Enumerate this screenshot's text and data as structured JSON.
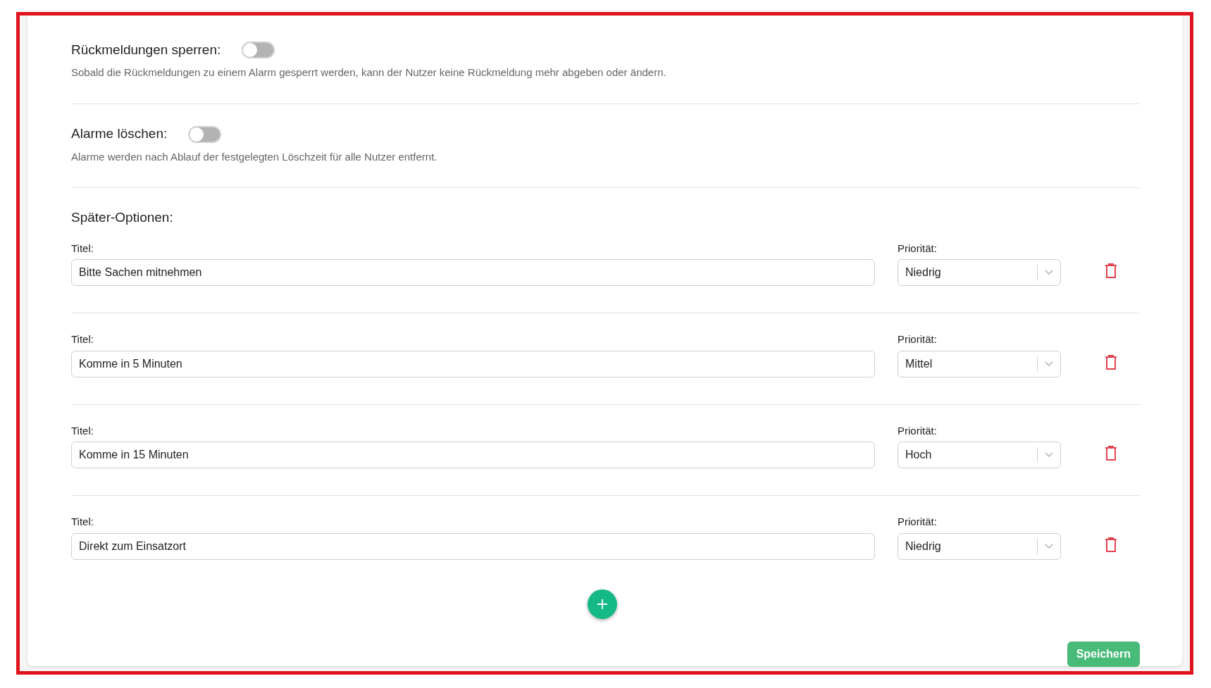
{
  "settings": [
    {
      "title": "Rückmeldungen sperren:",
      "on": false,
      "description": "Sobald die Rückmeldungen zu einem Alarm gesperrt werden, kann der Nutzer keine Rückmeldung mehr abgeben oder ändern."
    },
    {
      "title": "Alarme löschen:",
      "on": false,
      "description": "Alarme werden nach Ablauf der festgelegten Löschzeit für alle Nutzer entfernt."
    }
  ],
  "later_options": {
    "heading": "Später-Optionen:",
    "rows": [
      {
        "title_label": "Titel:",
        "title": "Bitte Sachen mitnehmen",
        "priority_label": "Priorität:",
        "priority": "Niedrig"
      },
      {
        "title_label": "Titel:",
        "title": "Komme in 5 Minuten",
        "priority_label": "Priorität:",
        "priority": "Mittel"
      },
      {
        "title_label": "Titel:",
        "title": "Komme in 15 Minuten",
        "priority_label": "Priorität:",
        "priority": "Hoch"
      },
      {
        "title_label": "Titel:",
        "title": "Direkt zum Einsatzort",
        "priority_label": "Priorität:",
        "priority": "Niedrig"
      }
    ]
  },
  "save_button": "Speichern"
}
